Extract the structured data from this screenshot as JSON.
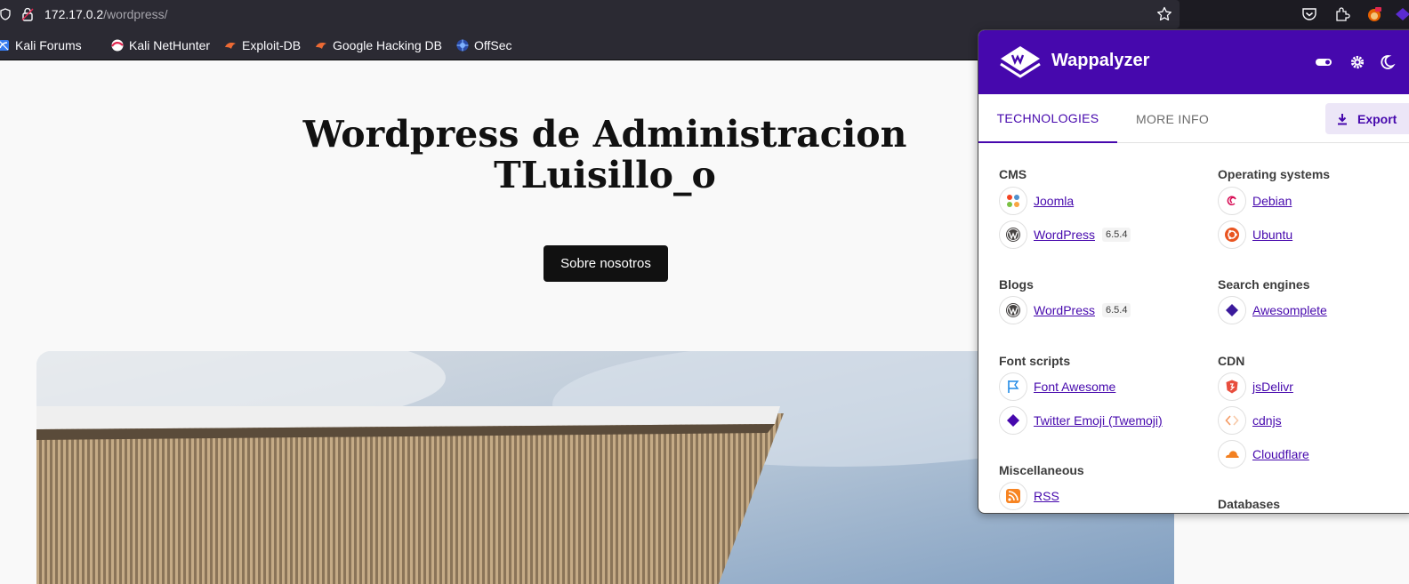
{
  "browser": {
    "url_host": "172.17.0.2",
    "url_path": "/wordpress/"
  },
  "bookmarks": [
    {
      "label": "Kali Forums",
      "icon": "kali-forums-icon"
    },
    {
      "label": "Kali NetHunter",
      "icon": "kali-nethunter-icon"
    },
    {
      "label": "Exploit-DB",
      "icon": "exploit-db-icon"
    },
    {
      "label": "Google Hacking DB",
      "icon": "ghdb-icon"
    },
    {
      "label": "OffSec",
      "icon": "offsec-icon"
    }
  ],
  "page": {
    "title_line1": "Wordpress de Administracion",
    "title_line2": "TLuisillo_o",
    "cta_label": "Sobre nosotros"
  },
  "wappalyzer": {
    "brand": "Wappalyzer",
    "brand_color": "#4608ad",
    "tabs": {
      "technologies": "TECHNOLOGIES",
      "more_info": "MORE INFO"
    },
    "export_label": "Export",
    "categories": {
      "cms": {
        "title": "CMS",
        "items": [
          {
            "name": "Joomla",
            "version": ""
          },
          {
            "name": "WordPress",
            "version": "6.5.4"
          }
        ]
      },
      "blogs": {
        "title": "Blogs",
        "items": [
          {
            "name": "WordPress",
            "version": "6.5.4"
          }
        ]
      },
      "font_scripts": {
        "title": "Font scripts",
        "items": [
          {
            "name": "Font Awesome"
          },
          {
            "name": "Twitter Emoji (Twemoji)"
          }
        ]
      },
      "misc": {
        "title": "Miscellaneous",
        "items": [
          {
            "name": "RSS"
          }
        ]
      },
      "os": {
        "title": "Operating systems",
        "items": [
          {
            "name": "Debian"
          },
          {
            "name": "Ubuntu"
          }
        ]
      },
      "search": {
        "title": "Search engines",
        "items": [
          {
            "name": "Awesomplete"
          }
        ]
      },
      "cdn": {
        "title": "CDN",
        "items": [
          {
            "name": "jsDelivr"
          },
          {
            "name": "cdnjs"
          },
          {
            "name": "Cloudflare"
          }
        ]
      },
      "databases": {
        "title": "Databases"
      }
    }
  }
}
